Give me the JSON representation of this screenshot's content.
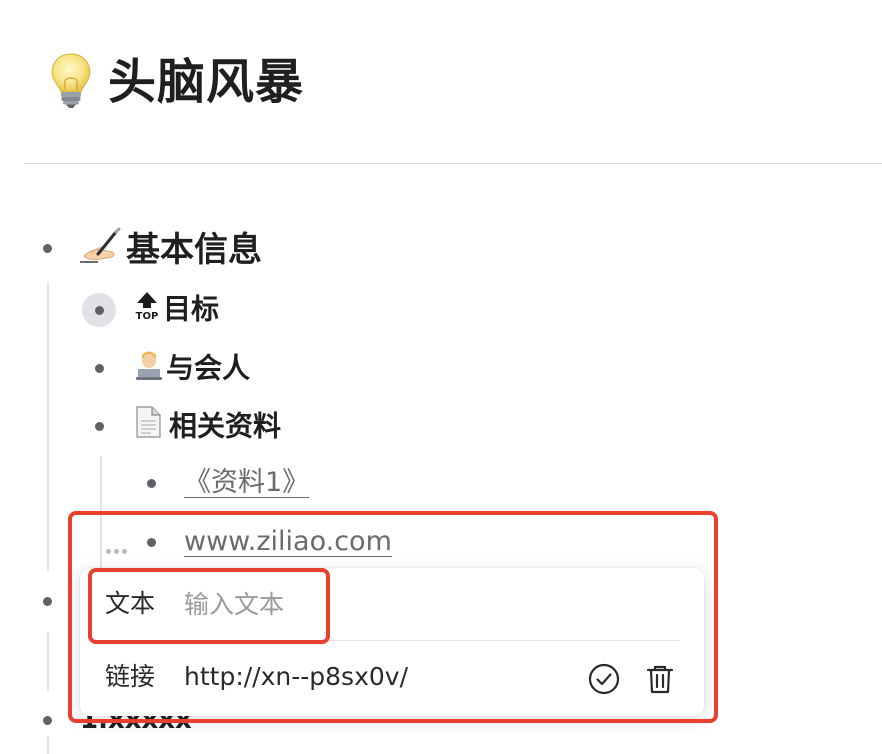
{
  "page": {
    "title": "头脑风暴",
    "title_icon": "lightbulb-icon"
  },
  "outline": {
    "basic_info": {
      "label": "基本信息",
      "icon": "writing-hand-icon"
    },
    "goal": {
      "label": "目标",
      "icon": "top-arrow-icon"
    },
    "attendees": {
      "label": "与会人",
      "icon": "technologist-icon"
    },
    "materials": {
      "label": "相关资料",
      "icon": "page-document-icon"
    },
    "material_1": {
      "label": "《资料1》"
    },
    "material_2": {
      "label": "www.ziliao.com"
    },
    "next_item": {
      "label": "1.xxxxx"
    }
  },
  "link_editor": {
    "text_label": "文本",
    "text_placeholder": "输入文本",
    "text_value": "",
    "link_label": "链接",
    "link_value": "http://xn--p8sx0v/",
    "confirm_icon": "check-circle-icon",
    "delete_icon": "trash-icon"
  },
  "colors": {
    "annotation_red": "#e8402f",
    "bullet": "#5f6066",
    "link_gray": "#6b6b6b"
  }
}
